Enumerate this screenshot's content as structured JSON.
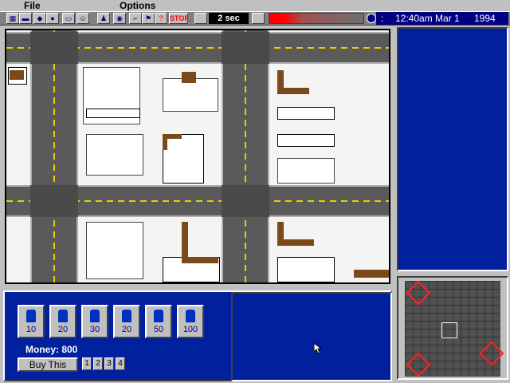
{
  "menu": {
    "file": "File",
    "options": "Options"
  },
  "toolbar": {
    "speed": "2 sec",
    "stop_label": "STOP",
    "help_label": "?"
  },
  "status": {
    "colon": ":",
    "time": "12:40am Mar 1",
    "year": "1994"
  },
  "units": [
    {
      "cost": "10"
    },
    {
      "cost": "20"
    },
    {
      "cost": "30"
    },
    {
      "cost": "20"
    },
    {
      "cost": "50"
    },
    {
      "cost": "100"
    }
  ],
  "shop": {
    "money": "Money: 800",
    "buy_label": "Buy This",
    "pages": [
      "1",
      "2",
      "3",
      "4"
    ]
  },
  "colors": {
    "panel_blue": "#00209e",
    "road": "#5a5a5a",
    "lane": "#e8d000"
  }
}
